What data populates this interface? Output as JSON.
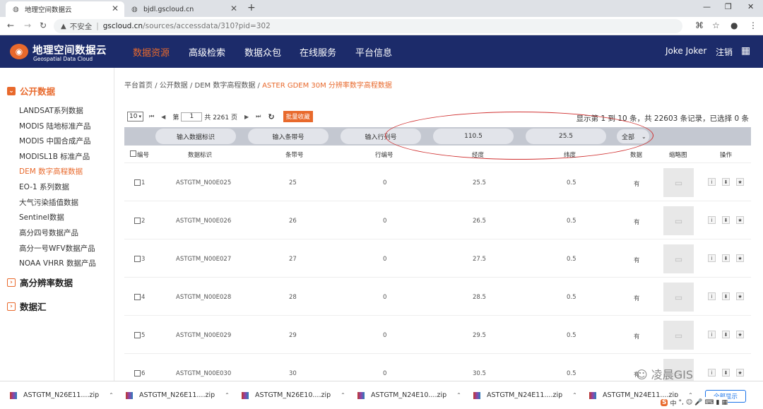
{
  "browser": {
    "tabs": [
      {
        "title": "地理空间数据云",
        "active": true
      },
      {
        "title": "bjdl.gscloud.cn",
        "active": false
      }
    ],
    "url": {
      "security": "不安全",
      "domain": "gscloud.cn",
      "path": "/sources/accessdata/310?pid=302"
    }
  },
  "site": {
    "logo_main": "地理空间数据云",
    "logo_sub": "Geospatial Data Cloud",
    "nav": [
      "数据资源",
      "高级检索",
      "数据众包",
      "在线服务",
      "平台信息"
    ],
    "user": "Joke Joker",
    "logout": "注销"
  },
  "sidebar": {
    "categories": [
      {
        "label": "公开数据",
        "open": true
      },
      {
        "label": "高分辨率数据",
        "open": false
      },
      {
        "label": "数据汇",
        "open": false
      }
    ],
    "items": [
      "LANDSAT系列数据",
      "MODIS 陆地标准产品",
      "MODIS 中国合成产品",
      "MODISL1B 标准产品",
      "DEM 数字高程数据",
      "EO-1 系列数据",
      "大气污染插值数据",
      "Sentinel数据",
      "高分四号数据产品",
      "高分一号WFV数据产品",
      "NOAA VHRR 数据产品"
    ],
    "active_item": "DEM 数字高程数据"
  },
  "breadcrumb": {
    "items": [
      "平台首页",
      "公开数据",
      "DEM 数字高程数据"
    ],
    "current": "ASTER GDEM 30M 分辨率数字高程数据",
    "separator": "/"
  },
  "pager": {
    "page_size": "10",
    "page_prefix": "第",
    "page_value": "1",
    "page_suffix": "共 2261 页",
    "collect": "批量收藏",
    "summary": "显示第 1 到 10 条，共 22603 条记录，已选择 0 条"
  },
  "filters": {
    "data_id_placeholder": "输入数据标识",
    "strip_placeholder": "输入条带号",
    "row_placeholder": "输入行列号",
    "longitude": "110.5",
    "latitude": "25.5",
    "data_select": "全部"
  },
  "table": {
    "headers": [
      "编号",
      "数据标识",
      "条带号",
      "行编号",
      "经度",
      "纬度",
      "数据",
      "缩略图",
      "操作"
    ],
    "rows": [
      {
        "no": "1",
        "id": "ASTGTM_N00E025",
        "strip": "25",
        "row": "0",
        "lon": "25.5",
        "lat": "0.5",
        "data": "有"
      },
      {
        "no": "2",
        "id": "ASTGTM_N00E026",
        "strip": "26",
        "row": "0",
        "lon": "26.5",
        "lat": "0.5",
        "data": "有"
      },
      {
        "no": "3",
        "id": "ASTGTM_N00E027",
        "strip": "27",
        "row": "0",
        "lon": "27.5",
        "lat": "0.5",
        "data": "有"
      },
      {
        "no": "4",
        "id": "ASTGTM_N00E028",
        "strip": "28",
        "row": "0",
        "lon": "28.5",
        "lat": "0.5",
        "data": "有"
      },
      {
        "no": "5",
        "id": "ASTGTM_N00E029",
        "strip": "29",
        "row": "0",
        "lon": "29.5",
        "lat": "0.5",
        "data": "有"
      },
      {
        "no": "6",
        "id": "ASTGTM_N00E030",
        "strip": "30",
        "row": "0",
        "lon": "30.5",
        "lat": "0.5",
        "data": "有"
      }
    ]
  },
  "watermark": "凌晨GIS",
  "downloads": {
    "files": [
      "ASTGTM_N26E11....zip",
      "ASTGTM_N26E11....zip",
      "ASTGTM_N26E10....zip",
      "ASTGTM_N24E10....zip",
      "ASTGTM_N24E11....zip",
      "ASTGTM_N24E11....zip"
    ],
    "show_all": "全部显示"
  },
  "ime": {
    "logo": "S",
    "mode": "中"
  },
  "colors": {
    "brand": "#1c2b6a",
    "accent": "#e8692c",
    "annotation": "#d03030"
  }
}
